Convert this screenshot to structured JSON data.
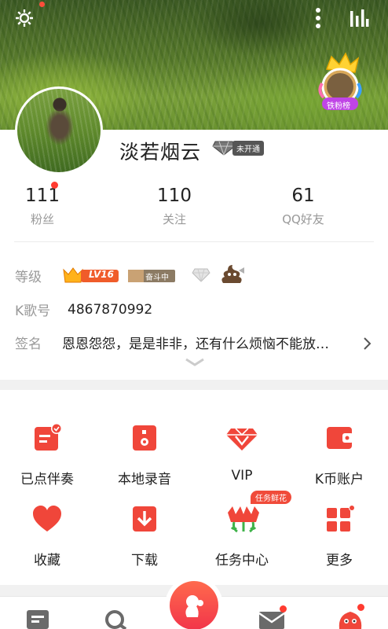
{
  "header": {
    "icons": [
      "gear-icon",
      "more-vertical-icon",
      "stats-icon"
    ],
    "badge_text": "铁粉榜"
  },
  "profile": {
    "username": "淡若烟云",
    "vip_status": "未开通",
    "stats": [
      {
        "value": "111",
        "label": "粉丝"
      },
      {
        "value": "110",
        "label": "关注"
      },
      {
        "value": "61",
        "label": "QQ好友"
      }
    ]
  },
  "info": {
    "level_label": "等级",
    "level_badge": "LV16",
    "rank_badge": "奋斗中",
    "kid_label": "K歌号",
    "kid_value": "4867870992",
    "sign_label": "签名",
    "sign_value": "恩恩怨怨，是是非非，还有什么烦恼不能放…"
  },
  "grid": [
    {
      "label": "已点伴奏",
      "icon": "accompaniment-icon"
    },
    {
      "label": "本地录音",
      "icon": "local-recording-icon"
    },
    {
      "label": "VIP",
      "icon": "vip-diamond-icon"
    },
    {
      "label": "K币账户",
      "icon": "wallet-icon"
    },
    {
      "label": "收藏",
      "icon": "heart-icon"
    },
    {
      "label": "下载",
      "icon": "download-icon"
    },
    {
      "label": "任务中心",
      "icon": "flower-icon"
    },
    {
      "label": "更多",
      "icon": "more-grid-icon"
    }
  ],
  "task_tag": "任务鲜花",
  "colors": {
    "accent": "#f04b3a",
    "muted_text": "#999999",
    "divider": "#f1f1f1"
  }
}
